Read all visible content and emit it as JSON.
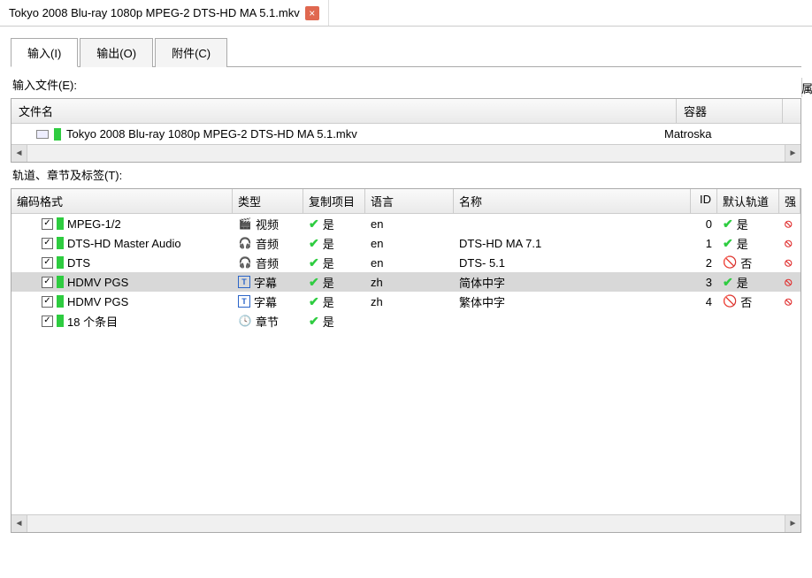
{
  "docTab": {
    "title": "Tokyo 2008 Blu-ray 1080p MPEG-2 DTS-HD MA 5.1.mkv"
  },
  "rightLabel": "属",
  "tabs": {
    "input": "输入(I)",
    "output": "输出(O)",
    "attach": "附件(C)"
  },
  "labels": {
    "inputFiles": "输入文件(E):",
    "tracksEtc": "轨道、章节及标签(T):"
  },
  "fileHeaders": {
    "name": "文件名",
    "container": "容器"
  },
  "file": {
    "name": "Tokyo 2008 Blu-ray 1080p MPEG-2 DTS-HD MA 5.1.mkv",
    "container": "Matroska"
  },
  "trackHeaders": {
    "codec": "编码格式",
    "type": "类型",
    "copy": "复制项目",
    "lang": "语言",
    "name": "名称",
    "id": "ID",
    "def": "默认轨道",
    "extra": "强"
  },
  "yes": "是",
  "no": "否",
  "tracks": [
    {
      "codec": "MPEG-1/2",
      "typeIcon": "video",
      "typeGlyph": "🎬",
      "type": "视频",
      "copy": true,
      "lang": "en",
      "name": "",
      "id": "0",
      "def": true,
      "sel": false
    },
    {
      "codec": "DTS-HD Master Audio",
      "typeIcon": "audio",
      "typeGlyph": "🎧",
      "type": "音频",
      "copy": true,
      "lang": "en",
      "name": "DTS-HD MA 7.1",
      "id": "1",
      "def": true,
      "sel": false
    },
    {
      "codec": "DTS",
      "typeIcon": "audio",
      "typeGlyph": "🎧",
      "type": "音频",
      "copy": true,
      "lang": "en",
      "name": "DTS- 5.1",
      "id": "2",
      "def": false,
      "sel": false
    },
    {
      "codec": "HDMV PGS",
      "typeIcon": "sub",
      "typeGlyph": "T",
      "type": "字幕",
      "copy": true,
      "lang": "zh",
      "name": "简体中字",
      "id": "3",
      "def": true,
      "sel": true
    },
    {
      "codec": "HDMV PGS",
      "typeIcon": "sub",
      "typeGlyph": "T",
      "type": "字幕",
      "copy": true,
      "lang": "zh",
      "name": "繁体中字",
      "id": "4",
      "def": false,
      "sel": false
    },
    {
      "codec": "18 个条目",
      "typeIcon": "chap",
      "typeGlyph": "🕓",
      "type": "章节",
      "copy": true,
      "lang": "",
      "name": "",
      "id": "",
      "def": null,
      "sel": false
    }
  ]
}
